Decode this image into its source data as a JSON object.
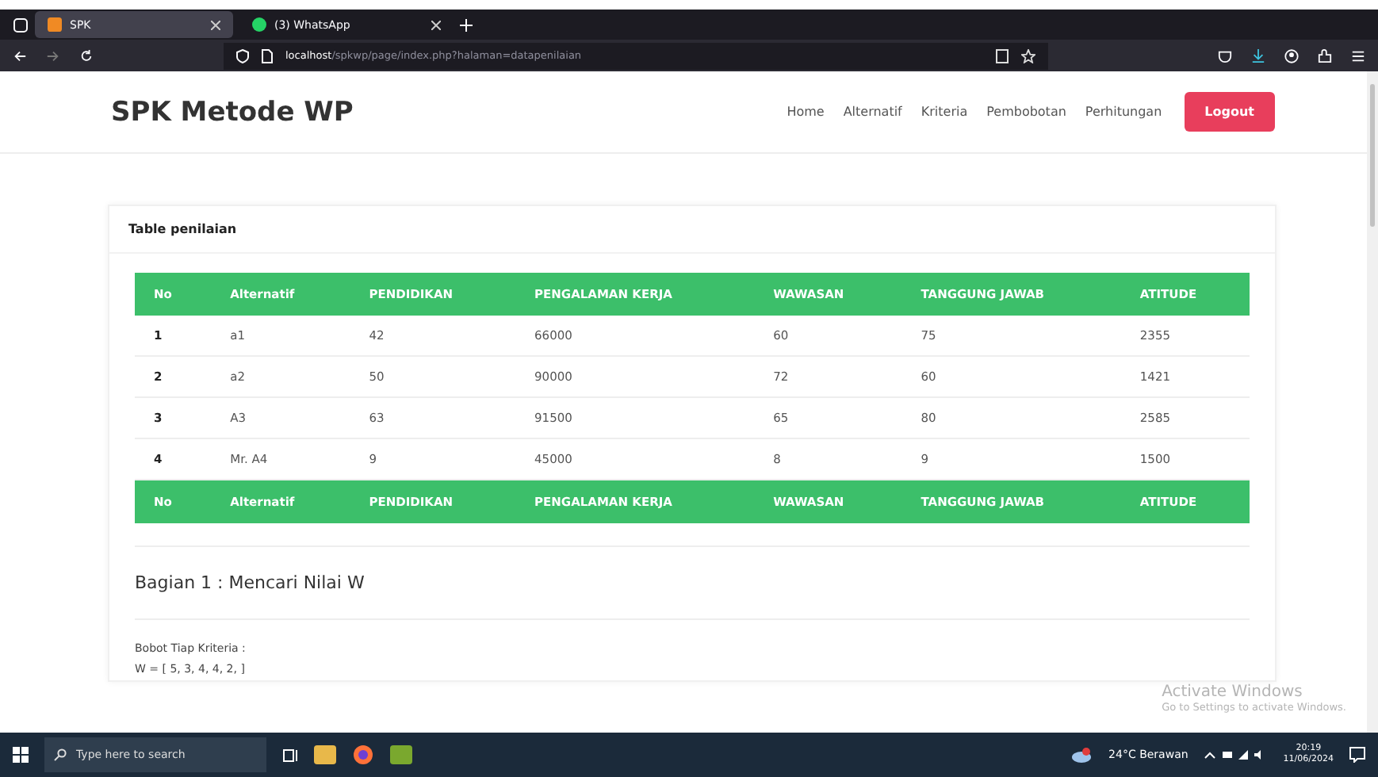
{
  "browser": {
    "tabs": [
      {
        "title": "SPK",
        "selected": true
      },
      {
        "title": "(3) WhatsApp",
        "selected": false
      }
    ],
    "url_host": "localhost",
    "url_path": "/spkwp/page/index.php?halaman=datapenilaian"
  },
  "navbar": {
    "brand": "SPK Metode WP",
    "links": [
      "Home",
      "Alternatif",
      "Kriteria",
      "Pembobotan",
      "Perhitungan"
    ],
    "logout": "Logout"
  },
  "card": {
    "title": "Table penilaian",
    "columns": [
      "No",
      "Alternatif",
      "PENDIDIKAN",
      "PENGALAMAN KERJA",
      "WAWASAN",
      "TANGGUNG JAWAB",
      "ATITUDE"
    ],
    "rows": [
      [
        "1",
        "a1",
        "42",
        "66000",
        "60",
        "75",
        "2355"
      ],
      [
        "2",
        "a2",
        "50",
        "90000",
        "72",
        "60",
        "1421"
      ],
      [
        "3",
        "A3",
        "63",
        "91500",
        "65",
        "80",
        "2585"
      ],
      [
        "4",
        "Mr. A4",
        "9",
        "45000",
        "8",
        "9",
        "1500"
      ]
    ],
    "footer": [
      "No",
      "Alternatif",
      "PENDIDIKAN",
      "PENGALAMAN KERJA",
      "WAWASAN",
      "TANGGUNG JAWAB",
      "ATITUDE"
    ]
  },
  "section": {
    "heading": "Bagian 1 : Mencari Nilai W",
    "label": "Bobot Tiap Kriteria :",
    "formula": "W = [ 5, 3, 4, 4, 2, ]"
  },
  "activation": {
    "title": "Activate Windows",
    "subtitle": "Go to Settings to activate Windows."
  },
  "taskbar": {
    "search_placeholder": "Type here to search",
    "weather": "24°C Berawan",
    "time": "20:19",
    "date": "11/06/2024"
  }
}
